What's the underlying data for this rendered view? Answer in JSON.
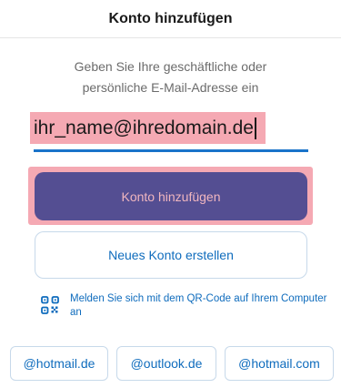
{
  "header": {
    "title": "Konto hinzufügen"
  },
  "instructions": {
    "line1": "Geben Sie Ihre geschäftliche oder",
    "line2": "persönliche E-Mail-Adresse ein"
  },
  "email_field": {
    "value": "ihr_name@ihredomain.de"
  },
  "buttons": {
    "add_account": "Konto hinzufügen",
    "create_account": "Neues Konto erstellen"
  },
  "qr": {
    "icon": "qr-code-icon",
    "text": "Melden Sie sich mit dem QR-Code auf Ihrem Computer an"
  },
  "domain_suggestions": [
    "@hotmail.de",
    "@outlook.de",
    "@hotmail.com"
  ],
  "colors": {
    "accent": "#0f6cbd",
    "primary_button": "#544e92",
    "highlight": "#f5a9b3",
    "underline": "#1a73c9"
  }
}
